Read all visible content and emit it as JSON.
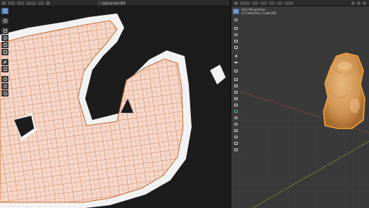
{
  "uv_editor": {
    "image_name": "...rotat.pncom.001",
    "toolbar_tools": [
      "select-tool",
      "cursor-tool",
      "move-tool",
      "rotate-tool",
      "scale-tool",
      "transform-tool",
      "annotate-tool",
      "rip-tool",
      "grab-tool",
      "relax-tool",
      "pinch-tool"
    ]
  },
  "viewport": {
    "view_name": "User Perspective",
    "collection": "(1) Collection | Cube.001",
    "toolbar_tools": [
      "select-tool",
      "cursor-tool",
      "move-tool",
      "rotate-tool",
      "scale-tool",
      "transform-tool",
      "annotate-tool",
      "measure-tool",
      "add-cube-tool",
      "extrude-tool",
      "inset-tool",
      "bevel-tool",
      "loopcut-tool",
      "knife-tool",
      "polybuild-tool",
      "spin-tool",
      "smooth-tool",
      "edge-slide-tool",
      "shrink-tool",
      "shear-tool",
      "rip-tool"
    ]
  },
  "colors": {
    "uv_face_fill": "#f6d8cc",
    "uv_edge": "#c06a2e",
    "selection_outline": "#f2f2f2",
    "object_color": "#d9a05f",
    "object_highlight": "#f7a23a",
    "active_tool": "#4772b3",
    "x_axis": "#8b3c3c",
    "y_axis": "#6f8a3a"
  }
}
